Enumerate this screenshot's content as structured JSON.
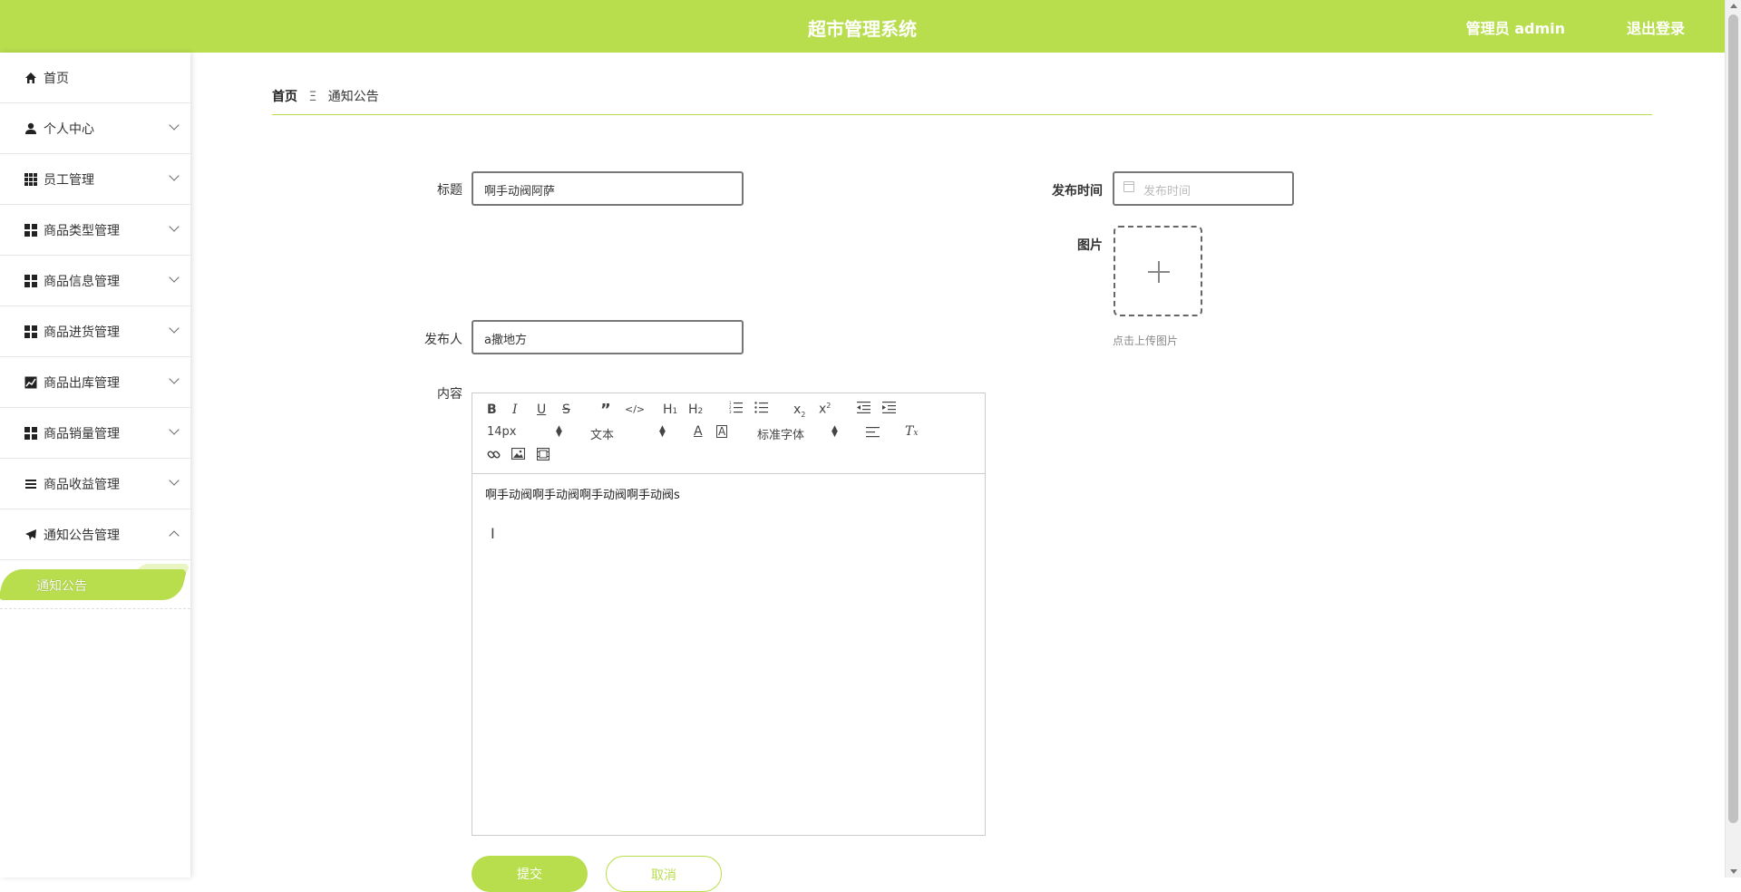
{
  "header": {
    "title": "超市管理系统",
    "admin_label": "管理员 admin",
    "logout_label": "退出登录"
  },
  "sidebar": {
    "items": [
      {
        "label": "首页",
        "icon": "home-icon"
      },
      {
        "label": "个人中心",
        "icon": "user-icon"
      },
      {
        "label": "员工管理",
        "icon": "grid9-icon"
      },
      {
        "label": "商品类型管理",
        "icon": "grid4-icon"
      },
      {
        "label": "商品信息管理",
        "icon": "grid4-icon"
      },
      {
        "label": "商品进货管理",
        "icon": "grid4-icon"
      },
      {
        "label": "商品出库管理",
        "icon": "chart-icon"
      },
      {
        "label": "商品销量管理",
        "icon": "grid4-icon"
      },
      {
        "label": "商品收益管理",
        "icon": "list-icon"
      },
      {
        "label": "通知公告管理",
        "icon": "send-icon"
      }
    ],
    "active_sub": "通知公告"
  },
  "breadcrumb": {
    "home": "首页",
    "separator": "Ξ",
    "current": "通知公告"
  },
  "form": {
    "title_label": "标题",
    "title_value": "啊手动阀阿萨",
    "publish_time_label": "发布时间",
    "publish_time_placeholder": "发布时间",
    "image_label": "图片",
    "upload_tip": "点击上传图片",
    "publisher_label": "发布人",
    "publisher_value": "a撒地方",
    "content_label": "内容",
    "content_value": "啊手动阀啊手动阀啊手动阀啊手动阀s"
  },
  "editor_toolbar": {
    "font_size": "14px",
    "block_format": "文本",
    "font_family": "标准字体"
  },
  "buttons": {
    "submit": "提交",
    "cancel": "取消"
  },
  "colors": {
    "accent": "#b8dd4d"
  }
}
